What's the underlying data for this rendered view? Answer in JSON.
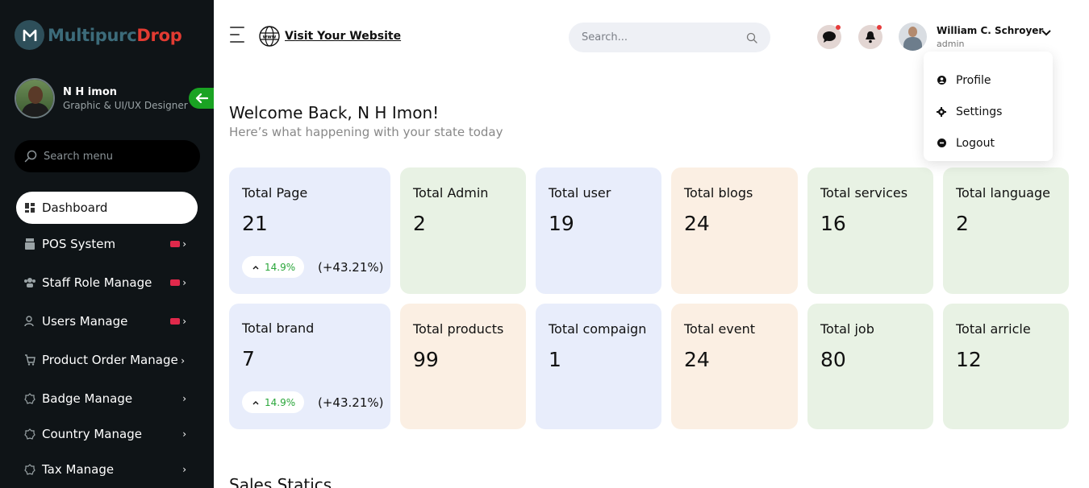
{
  "brand": {
    "name_part1": "Multipurc",
    "name_part2": "Drop",
    "logo_letter": "M"
  },
  "profile": {
    "name": "N H imon",
    "role": "Graphic & UI/UX Designer"
  },
  "sidebar": {
    "search_placeholder": "Search menu",
    "items": [
      {
        "label": "Dashboard",
        "icon": "dashboard-icon",
        "active": true
      },
      {
        "label": "POS System",
        "icon": "pos-icon"
      },
      {
        "label": "Staff Role Manage",
        "icon": "staff-icon"
      },
      {
        "label": "Users Manage",
        "icon": "users-icon"
      },
      {
        "label": "Product Order Manage",
        "icon": "order-icon"
      },
      {
        "label": "Badge Manage",
        "icon": "badge-icon"
      },
      {
        "label": "Country Manage",
        "icon": "country-icon"
      },
      {
        "label": "Tax Manage",
        "icon": "tax-icon"
      }
    ]
  },
  "topbar": {
    "visit_label": "Visit Your Website",
    "search_placeholder": "Search...",
    "user_name": "William C. Schroyer",
    "user_role": "admin"
  },
  "dropdown": {
    "items": [
      "Profile",
      "Settings",
      "Logout"
    ]
  },
  "welcome": {
    "title": "Welcome Back, N H Imon!",
    "subtitle": "Here’s what happening with your state today"
  },
  "cards": [
    {
      "label": "Total Page",
      "value": "21",
      "trend": "14.9%",
      "change": "(+43.21%)",
      "color": "#e8edfb"
    },
    {
      "label": "Total Admin",
      "value": "2",
      "color": "#e8f2e4"
    },
    {
      "label": "Total user",
      "value": "19",
      "color": "#e8edfb"
    },
    {
      "label": "Total blogs",
      "value": "24",
      "color": "#fbefe3"
    },
    {
      "label": "Total services",
      "value": "16",
      "color": "#e8f2e4"
    },
    {
      "label": "Total language",
      "value": "2",
      "color": "#e8f2e4"
    },
    {
      "label": "Total brand",
      "value": "7",
      "trend": "14.9%",
      "change": "(+43.21%)",
      "color": "#e8edfb"
    },
    {
      "label": "Total products",
      "value": "99",
      "color": "#fbefe3"
    },
    {
      "label": "Total compaign",
      "value": "1",
      "color": "#e8edfb"
    },
    {
      "label": "Total event",
      "value": "24",
      "color": "#fbefe3"
    },
    {
      "label": "Total job",
      "value": "80",
      "color": "#e8f2e4"
    },
    {
      "label": "Total arricle",
      "value": "12",
      "color": "#e8f2e4"
    }
  ],
  "sales_title": "Sales Statics"
}
